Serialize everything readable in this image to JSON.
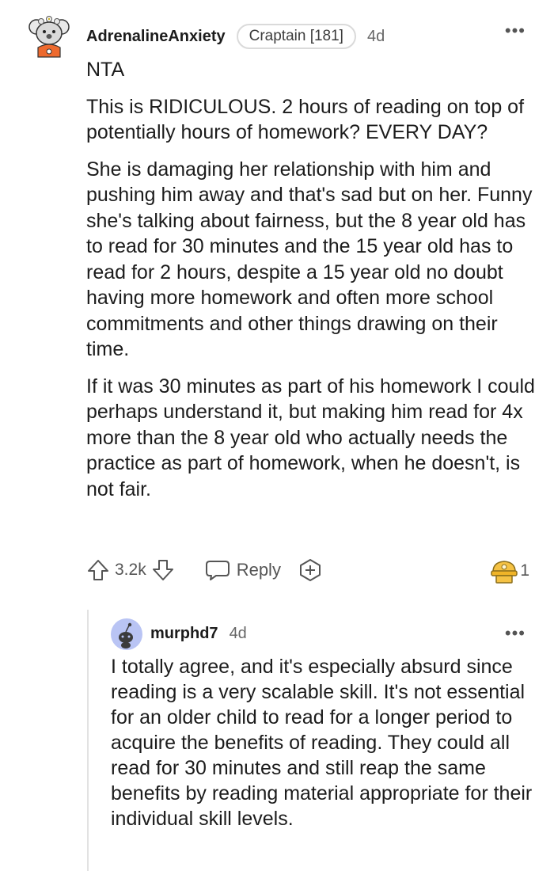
{
  "comment": {
    "username": "AdrenalineAnxiety",
    "flair": "Craptain [181]",
    "age": "4d",
    "paragraphs": [
      "NTA",
      "This is RIDICULOUS. 2 hours of reading on top of potentially hours of homework? EVERY DAY?",
      "She is damaging her relationship with him and pushing him away and that's sad but on her. Funny she's talking about fairness, but the 8 year old has to read for 30 minutes and the 15 year old has to read for 2 hours, despite a 15 year old no doubt having more homework and often more school commitments and other things drawing on their time.",
      "If it was 30 minutes as part of his homework I could perhaps understand it, but making him read for 4x more than the 8 year old who actually needs the practice as part of homework, when he doesn't, is not fair."
    ],
    "score": "3.2k",
    "reply_label": "Reply",
    "award_count": "1",
    "more_label": "•••"
  },
  "reply": {
    "username": "murphd7",
    "age": "4d",
    "text": "I totally agree, and it's especially absurd since reading is a very scalable skill. It's not essential for an older child to read for a longer period to acquire the benefits of reading. They could all read for 30 minutes and still reap the same benefits by reading material appropriate for their individual skill levels.",
    "more_label": "•••"
  },
  "icons": {
    "upvote": "upvote-arrow-icon",
    "downvote": "downvote-arrow-icon",
    "reply": "speech-bubble-icon",
    "award": "add-award-icon",
    "given_award": "gold-award-icon"
  },
  "colors": {
    "text": "#1c1c1c",
    "muted": "#555555",
    "reply_avatar": "#b9c4f4",
    "award_gold": "#f5c244"
  }
}
